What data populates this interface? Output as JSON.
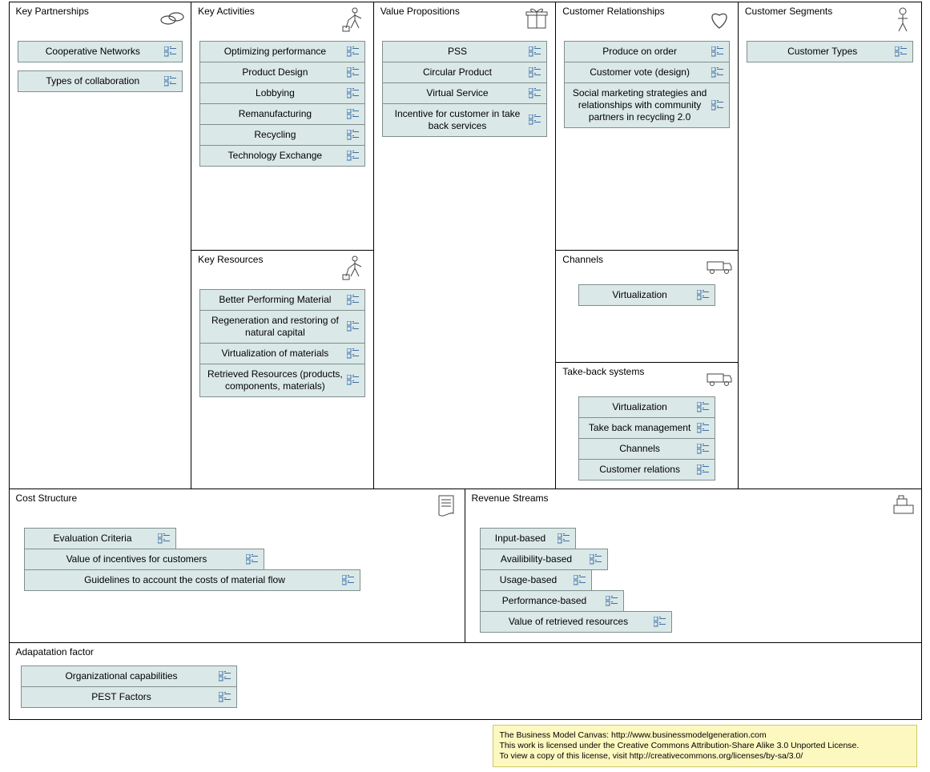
{
  "sections": {
    "key_partnerships": {
      "title": "Key Partnerships",
      "items": [
        "Cooperative Networks",
        "Types of collaboration"
      ]
    },
    "key_activities": {
      "title": "Key Activities",
      "items": [
        "Optimizing performance",
        "Product Design",
        "Lobbying",
        "Remanufacturing",
        "Recycling",
        "Technology Exchange"
      ]
    },
    "key_resources": {
      "title": "Key Resources",
      "items": [
        "Better Performing Material",
        "Regeneration and restoring of natural capital",
        "Virtualization of materials",
        "Retrieved Resources (products, components, materials)"
      ]
    },
    "value_propositions": {
      "title": "Value Propositions",
      "items": [
        "PSS",
        "Circular Product",
        "Virtual Service",
        "Incentive for customer in take back services"
      ]
    },
    "customer_relationships": {
      "title": "Customer Relationships",
      "items": [
        "Produce on order",
        "Customer vote (design)",
        "Social marketing strategies and relationships with community partners in recycling 2.0"
      ]
    },
    "channels": {
      "title": "Channels",
      "items": [
        "Virtualization"
      ]
    },
    "take_back_systems": {
      "title": "Take-back systems",
      "items": [
        "Virtualization",
        "Take back management",
        "Channels",
        "Customer relations"
      ]
    },
    "customer_segments": {
      "title": "Customer Segments",
      "items": [
        "Customer Types"
      ]
    },
    "cost_structure": {
      "title": "Cost Structure",
      "items": [
        "Evaluation Criteria",
        "Value of incentives for customers",
        "Guidelines to account the costs of material flow"
      ]
    },
    "revenue_streams": {
      "title": "Revenue Streams",
      "items": [
        "Input-based",
        "Availibility-based",
        "Usage-based",
        "Performance-based",
        "Value of retrieved resources"
      ]
    },
    "adaptation_factor": {
      "title": "Adapatation factor",
      "items": [
        "Organizational capabilities",
        "PEST Factors"
      ]
    }
  },
  "license": {
    "l1": "The Business Model Canvas: http://www.businessmodelgeneration.com",
    "l2": "This work is licensed under the Creative Commons Attribution-Share Alike 3.0 Unported License.",
    "l3": "To view a copy of this license, visit http://creativecommons.org/licenses/by-sa/3.0/"
  }
}
